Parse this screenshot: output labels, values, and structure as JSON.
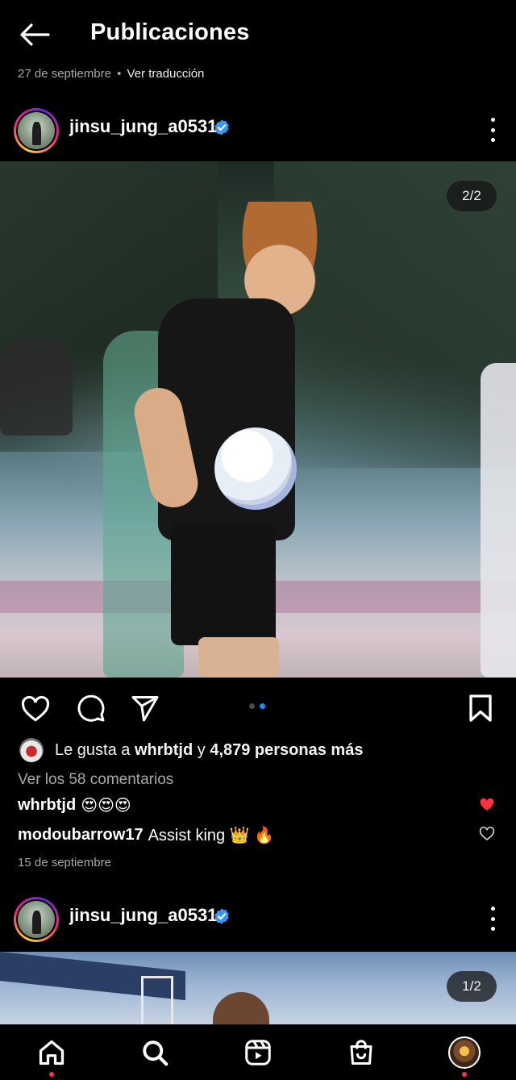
{
  "header": {
    "title": "Publicaciones"
  },
  "previous_post": {
    "date": "27 de septiembre",
    "separator": "•",
    "translate_label": "Ver traducción"
  },
  "post1": {
    "username": "jinsu_jung_a0531",
    "counter": "2/2",
    "likes": {
      "prefix": "Le gusta a",
      "user": "whrbtjd",
      "connector": "y",
      "others": "4,879 personas más"
    },
    "view_comments": "Ver los 58 comentarios",
    "comments": [
      {
        "user": "whrbtjd",
        "text": "😍😍😍",
        "liked": true
      },
      {
        "user": "modoubarrow17",
        "text": "Assist king 👑 🔥",
        "liked": false
      }
    ],
    "date": "15 de septiembre",
    "carousel": {
      "count": 2,
      "active_index": 1
    }
  },
  "post2": {
    "username": "jinsu_jung_a0531",
    "counter": "1/2"
  },
  "colors": {
    "verified": "#3897f0",
    "liked_heart": "#ff3040",
    "pager_active": "#1f8ff2",
    "nav_dot": "#ff3040"
  },
  "icons": {
    "back": "arrow-left-icon",
    "like": "heart-icon",
    "comment": "comment-icon",
    "share": "paper-plane-icon",
    "save": "bookmark-icon",
    "home": "home-icon",
    "search": "search-icon",
    "reels": "reels-icon",
    "shop": "shopping-bag-icon"
  }
}
